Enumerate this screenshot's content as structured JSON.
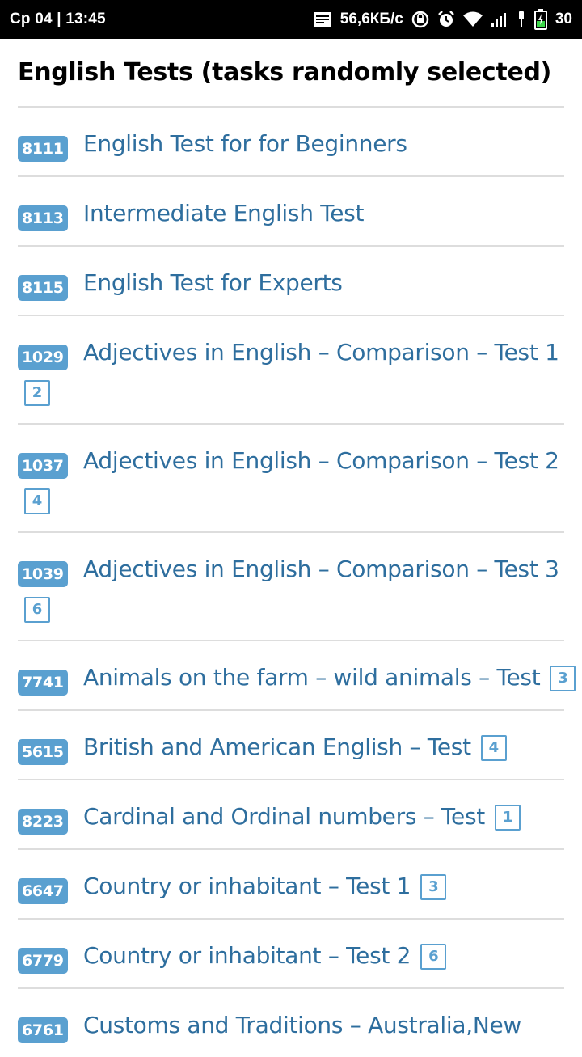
{
  "status_bar": {
    "time": "Ср 04 | 13:45",
    "speed": "56,6КБ/с",
    "battery_percent": "30",
    "icons": [
      "notification-icon",
      "data-saver-icon",
      "alarm-icon",
      "wifi-icon",
      "signal-icon",
      "charging-icon",
      "battery-icon"
    ]
  },
  "page": {
    "title": "English Tests (tasks randomly selected)"
  },
  "tests": [
    {
      "id": "8111",
      "title": "English Test for for Beginners",
      "count": ""
    },
    {
      "id": "8113",
      "title": "Intermediate English Test",
      "count": ""
    },
    {
      "id": "8115",
      "title": "English Test for Experts",
      "count": ""
    },
    {
      "id": "1029",
      "title": "Adjectives in English – Comparison – Test 1",
      "count": "2"
    },
    {
      "id": "1037",
      "title": "Adjectives in English – Comparison – Test 2",
      "count": "4"
    },
    {
      "id": "1039",
      "title": "Adjectives in English – Comparison – Test 3",
      "count": "6"
    },
    {
      "id": "7741",
      "title": "Animals on the farm – wild animals – Test",
      "count": "3"
    },
    {
      "id": "5615",
      "title": "British and American English – Test",
      "count": "4"
    },
    {
      "id": "8223",
      "title": "Cardinal and Ordinal numbers – Test",
      "count": "1"
    },
    {
      "id": "6647",
      "title": "Country or inhabitant – Test 1",
      "count": "3"
    },
    {
      "id": "6779",
      "title": "Country or inhabitant – Test 2",
      "count": "6"
    },
    {
      "id": "6761",
      "title": "Customs and Traditions – Australia,New",
      "count": ""
    }
  ],
  "colors": {
    "badge": "#5aa0d0",
    "link": "#2e6e9e",
    "divider": "#dddddd"
  }
}
